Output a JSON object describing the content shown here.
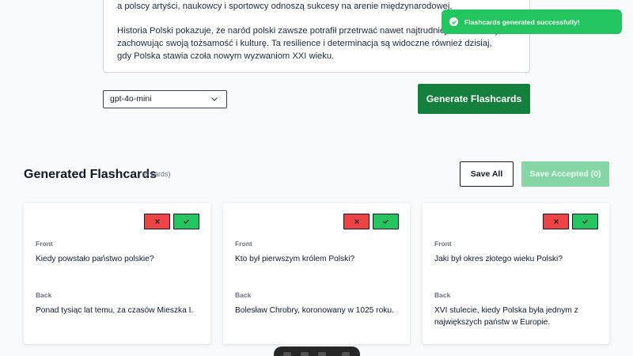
{
  "editor": {
    "line1": "a polscy artyści, naukowcy i sportowcy odnoszą sukcesy na arenie międzynarodowej.",
    "line2": "Historia Polski pokazuje, że naród polski zawsze potrafił przetrwać nawet najtrudniejsze momenty,",
    "line3": "zachowując swoją tożsamość i kulturę. Ta resilience i determinacja są widoczne również dzisiaj,",
    "line4": "gdy Polska stawia czoła nowym wyzwaniom XXI wieku."
  },
  "model_select": {
    "value": "gpt-4o-mini"
  },
  "generate_button": {
    "label": "Generate Flashcards"
  },
  "toast": {
    "message": "Flashcards generated successfully!"
  },
  "section": {
    "title": "Generated Flashcards",
    "count": "(8 cards)"
  },
  "actions": {
    "save_all": "Save All",
    "save_accepted": "Save Accepted (0)"
  },
  "cards": [
    {
      "front_label": "Front",
      "front": "Kiedy powstało państwo polskie?",
      "back_label": "Back",
      "back": "Ponad tysiąc lat temu, za czasów Mieszka I."
    },
    {
      "front_label": "Front",
      "front": "Kto był pierwszym królem Polski?",
      "back_label": "Back",
      "back": "Bolesław Chrobry, koronowany w 1025 roku."
    },
    {
      "front_label": "Front",
      "front": "Jaki był okres złotego wieku Polski?",
      "back_label": "Back",
      "back": "XVI stulecie, kiedy Polska była jednym z największych państw w Europie."
    }
  ],
  "colors": {
    "primary": "#15803d",
    "accent_light": "#86d6a6",
    "toast": "#22c55e",
    "reject": "#ef4444",
    "accept": "#22c55e"
  }
}
